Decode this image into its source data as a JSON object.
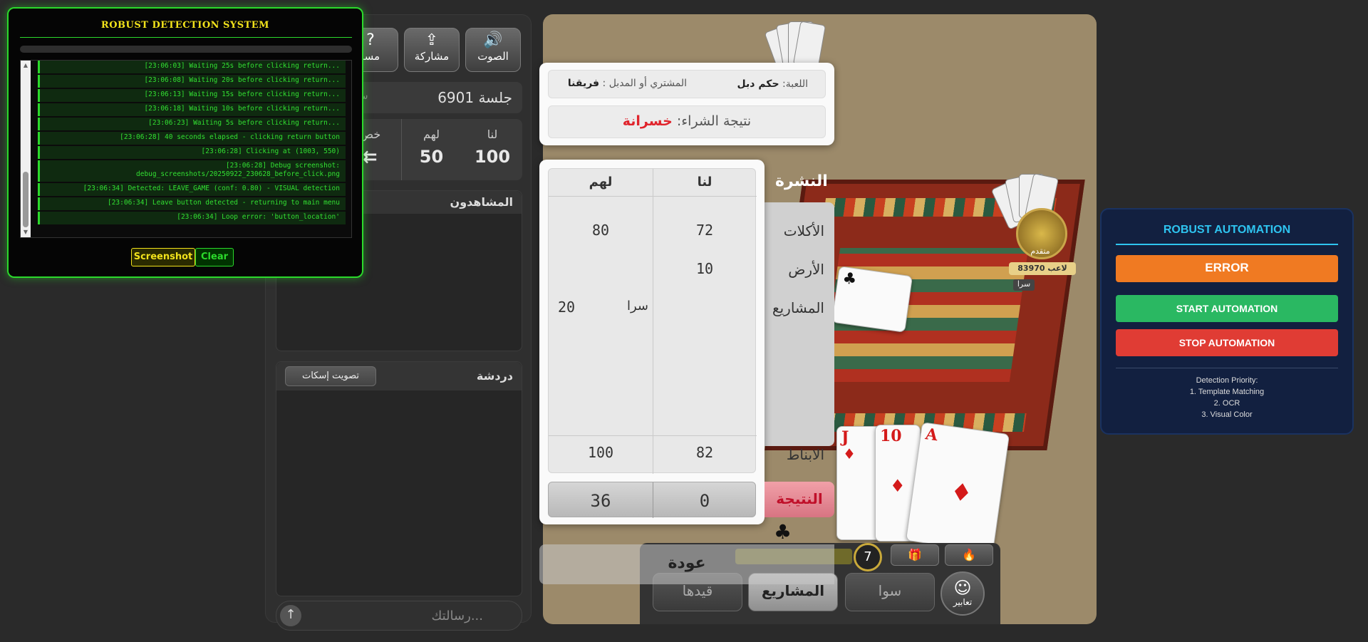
{
  "console": {
    "title": "ROBUST DETECTION SYSTEM",
    "logs": [
      "[23:06:03] Waiting 25s before clicking return...",
      "[23:06:08] Waiting 20s before clicking return...",
      "[23:06:13] Waiting 15s before clicking return...",
      "[23:06:18] Waiting 10s before clicking return...",
      "[23:06:23] Waiting 5s before clicking return...",
      "[23:06:28] 40 seconds elapsed - clicking return button",
      "[23:06:28] Clicking at (1003, 550)",
      "[23:06:28] Debug screenshot:",
      "debug_screenshots/20250922_230628_before_click.png",
      "[23:06:34] Detected: LEAVE_GAME (conf: 0.80) - VISUAL detection",
      "[23:06:34] Leave button detected - returning to main menu",
      "[23:06:34] Loop error: 'button_location'"
    ],
    "screenshot_label": "Screenshot",
    "clear_label": "Clear"
  },
  "sidebar": {
    "sound_label": "الصوت",
    "share_label": "مشاركة",
    "help_label": "مسا",
    "session": "جلسة 6901",
    "session_extra": "سر",
    "scores": {
      "us_label": "لنا",
      "us_value": "100",
      "them_label": "لهم",
      "them_value": "50",
      "extra_label": "خص"
    },
    "spectators_title": "المشاهدون",
    "chat_title": "دردشة",
    "mute_label": "تصويت إسكات",
    "message_placeholder": "رسالتك..."
  },
  "modal": {
    "game_label": "اللعبة:",
    "game_value": "حكم دبل",
    "buyer_label": "المشتري أو المدبل :",
    "buyer_value": "فريقنا",
    "buy_result_label": "نتيجة الشراء:",
    "buy_result_value": "خسرانة",
    "bulletin": "النشرة",
    "col_us": "لنا",
    "col_them": "لهم",
    "rows": [
      {
        "label": "الأكلات",
        "us": "72",
        "them": "80"
      },
      {
        "label": "الأرض",
        "us": "10",
        "them": ""
      },
      {
        "label": "المشاريع",
        "us": "سرا",
        "them": "20"
      }
    ],
    "abnat_label": "الابناط",
    "abnat_us": "82",
    "abnat_them": "100",
    "result_label": "النتيجة",
    "result_us": "0",
    "result_them": "36",
    "return_label": "عودة"
  },
  "board": {
    "avatar_name": "متقدم",
    "rank": "لاعب 83970",
    "player_label": "سرا",
    "timer": "7",
    "buttons": {
      "emote_label": "تعابير",
      "sawa_label": "سوا",
      "projects_label": "المشاريع",
      "qaydha_label": "قيدها"
    },
    "cards_hand": [
      {
        "rank": "J",
        "suit": "♦"
      },
      {
        "rank": "10",
        "suit": "♦"
      },
      {
        "rank": "A",
        "suit": "♦"
      }
    ]
  },
  "automation": {
    "title": "ROBUST AUTOMATION",
    "status": "ERROR",
    "start_label": "START AUTOMATION",
    "stop_label": "STOP AUTOMATION",
    "priority_title": "Detection Priority:",
    "priorities": [
      "1. Template Matching",
      "2. OCR",
      "3. Visual Color"
    ]
  },
  "colors": {
    "console_green": "#2bd92b",
    "console_yellow": "#f1e21b",
    "auto_accent": "#2ec4f0",
    "error_orange": "#f07a22",
    "start_green": "#2ab862",
    "stop_red": "#e03c34",
    "loss_red": "#e0242c"
  }
}
